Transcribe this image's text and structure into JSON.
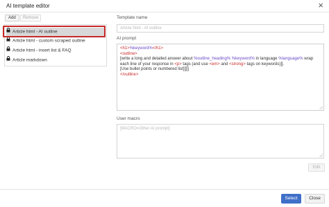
{
  "window": {
    "title": "AI template editor",
    "close_glyph": "×"
  },
  "toolbar": {
    "add_label": "Add",
    "remove_label": "Remove"
  },
  "templates": [
    {
      "label": "Article html - AI outline",
      "selected": true,
      "icon": "lock-icon"
    },
    {
      "label": "Article html - custom scraped outline",
      "selected": false,
      "icon": "lock-icon"
    },
    {
      "label": "Article html - insert list & FAQ",
      "selected": false,
      "icon": "lock-icon"
    },
    {
      "label": "Article markdown",
      "selected": false,
      "icon": "lock-icon"
    }
  ],
  "template_name": {
    "label": "Template name",
    "placeholder": "Article html - AI outline"
  },
  "ai_prompt": {
    "label": "AI prompt",
    "line1": {
      "open": "<h1>",
      "var": "%keyword%",
      "close": "</h1>"
    },
    "line2": "<outline>",
    "line3": {
      "a": "[write a long and detailed answer about ",
      "v1": "%outline_heading% %keyword%",
      "b": " in language ",
      "v2": "%language%",
      "c": " wrap"
    },
    "line4": {
      "a": "each line of your response in ",
      "t1": "<p>",
      "b": " tags (and use ",
      "t2": "<em>",
      "c": " and ",
      "t3": "<strong>",
      "d": " tags on keywords)]]."
    },
    "line5": "[Use bullet points or numbered list]]]]]",
    "line6": "</outline>"
  },
  "user_macro": {
    "label": "User macro",
    "placeholder": "[MACRO=Other AI prompt]"
  },
  "buttons": {
    "edit_label": "Edit",
    "select_label": "Select",
    "close_label": "Close"
  },
  "colors": {
    "primary": "#3f6fc7",
    "highlight_border": "#c62828",
    "tag_red": "#c62828",
    "var_purple": "#6a4bc4"
  }
}
